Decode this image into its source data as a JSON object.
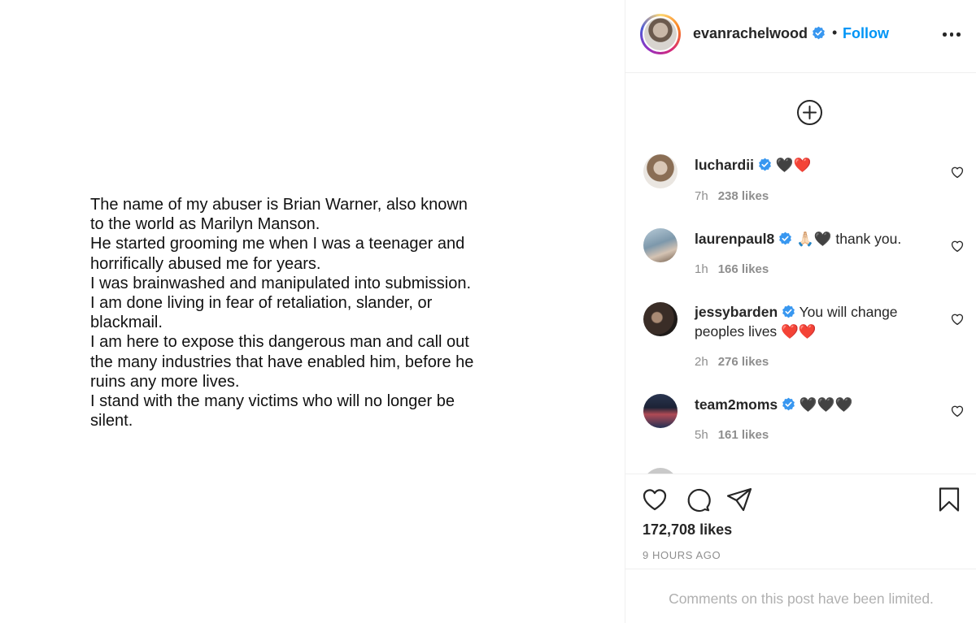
{
  "post": {
    "text_lines": [
      "The name of my abuser is Brian Warner, also known\nto the world as Marilyn Manson.\nHe started grooming me when I was a teenager and\nhorrifically abused me for years.\nI was brainwashed and manipulated into submission.\nI am done living in fear of retaliation, slander, or\nblackmail.\nI am here to expose this dangerous man and call out\nthe many industries that have enabled him, before he\nruins any more lives.\nI stand with the many victims who will no longer be\nsilent."
    ]
  },
  "header": {
    "username": "evanrachelwood",
    "separator": "•",
    "follow_label": "Follow",
    "verified_icon": "verified-badge-icon",
    "more_icon": "more-options-icon"
  },
  "comments": [
    {
      "user": "luchardii",
      "text": "🖤❤️",
      "time": "7h",
      "likes": "238 likes"
    },
    {
      "user": "laurenpaul8",
      "text": "🙏🏻🖤 thank you.",
      "time": "1h",
      "likes": "166 likes"
    },
    {
      "user": "jessybarden",
      "text": "You will change peoples lives ❤️❤️",
      "time": "2h",
      "likes": "276 likes"
    },
    {
      "user": "team2moms",
      "text": "🖤🖤🖤",
      "time": "5h",
      "likes": "161 likes"
    }
  ],
  "footer": {
    "likes": "172,708 likes",
    "time_ago": "9 HOURS AGO",
    "limited": "Comments on this post have been limited."
  },
  "colors": {
    "accent": "#0095f6",
    "text": "#262626",
    "muted": "#8e8e8e",
    "divider": "#efefef"
  }
}
